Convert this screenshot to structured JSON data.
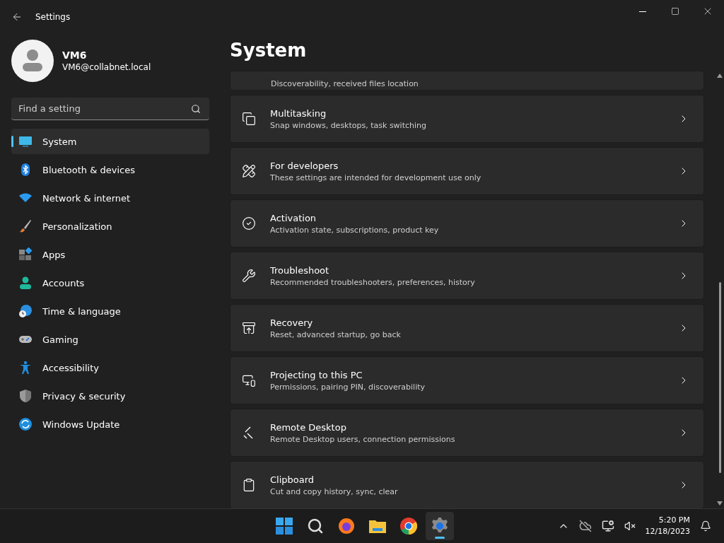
{
  "window": {
    "title": "Settings"
  },
  "user": {
    "name": "VM6",
    "email": "VM6@collabnet.local"
  },
  "search": {
    "placeholder": "Find a setting"
  },
  "nav": [
    {
      "label": "System",
      "kind": "system",
      "selected": true
    },
    {
      "label": "Bluetooth & devices",
      "kind": "bluetooth",
      "selected": false
    },
    {
      "label": "Network & internet",
      "kind": "network",
      "selected": false
    },
    {
      "label": "Personalization",
      "kind": "personalization",
      "selected": false
    },
    {
      "label": "Apps",
      "kind": "apps",
      "selected": false
    },
    {
      "label": "Accounts",
      "kind": "accounts",
      "selected": false
    },
    {
      "label": "Time & language",
      "kind": "time",
      "selected": false
    },
    {
      "label": "Gaming",
      "kind": "gaming",
      "selected": false
    },
    {
      "label": "Accessibility",
      "kind": "accessibility",
      "selected": false
    },
    {
      "label": "Privacy & security",
      "kind": "privacy",
      "selected": false
    },
    {
      "label": "Windows Update",
      "kind": "update",
      "selected": false
    }
  ],
  "page": {
    "title": "System"
  },
  "clipped_card": {
    "subtitle": "Discoverability, received files location"
  },
  "cards": [
    {
      "title": "Multitasking",
      "subtitle": "Snap windows, desktops, task switching",
      "kind": "multitasking"
    },
    {
      "title": "For developers",
      "subtitle": "These settings are intended for development use only",
      "kind": "developers"
    },
    {
      "title": "Activation",
      "subtitle": "Activation state, subscriptions, product key",
      "kind": "activation"
    },
    {
      "title": "Troubleshoot",
      "subtitle": "Recommended troubleshooters, preferences, history",
      "kind": "troubleshoot"
    },
    {
      "title": "Recovery",
      "subtitle": "Reset, advanced startup, go back",
      "kind": "recovery"
    },
    {
      "title": "Projecting to this PC",
      "subtitle": "Permissions, pairing PIN, discoverability",
      "kind": "projecting"
    },
    {
      "title": "Remote Desktop",
      "subtitle": "Remote Desktop users, connection permissions",
      "kind": "remote"
    },
    {
      "title": "Clipboard",
      "subtitle": "Cut and copy history, sync, clear",
      "kind": "clipboard"
    }
  ],
  "taskbar": {
    "apps": [
      {
        "kind": "start",
        "selected": false
      },
      {
        "kind": "search",
        "selected": false
      },
      {
        "kind": "browser",
        "selected": false
      },
      {
        "kind": "files",
        "selected": false
      },
      {
        "kind": "web",
        "selected": false
      },
      {
        "kind": "settings",
        "selected": true
      }
    ],
    "time": "5:20 PM",
    "date": "12/18/2023"
  }
}
